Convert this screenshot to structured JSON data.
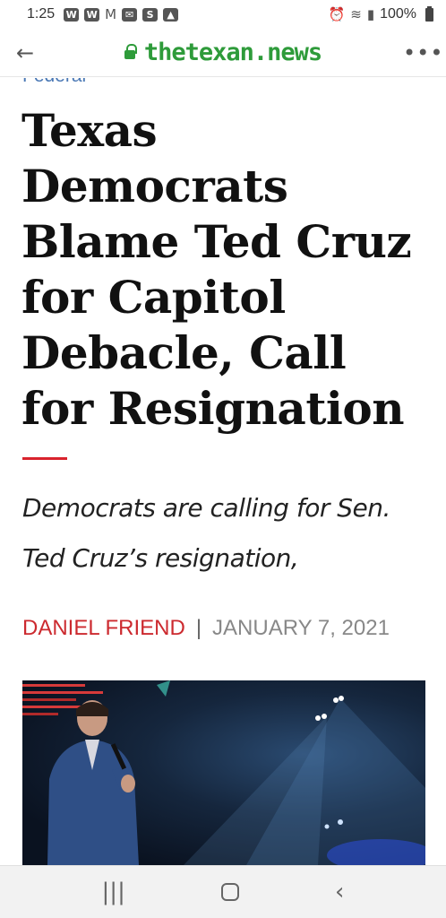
{
  "status_bar": {
    "time": "1:25",
    "battery": "100%",
    "left_icons": [
      "w-app-icon",
      "w-app-icon",
      "gmail-icon",
      "mail-icon",
      "shazam-icon",
      "gallery-icon"
    ],
    "right_icons": [
      "alarm-icon",
      "wifi-icon",
      "signal-icon",
      "battery-icon"
    ]
  },
  "browser": {
    "url": "thetexan.news",
    "back_icon": "back-arrow-icon",
    "menu_icon": "more-icon"
  },
  "article": {
    "category": "Federal",
    "headline_lines": [
      "Texas",
      "Democrats",
      "Blame Ted Cruz",
      "for Capitol",
      "Debacle, Call",
      "for Resignation"
    ],
    "subhead_lines": [
      "Democrats are calling for Sen.",
      "Ted Cruz’s resignation,"
    ],
    "author": "Daniel Friend",
    "separator": "|",
    "date": "January 7, 2021",
    "accent_color": "#d9232d",
    "author_color": "#cc2a2f",
    "category_color": "#4a78b5"
  },
  "nav": {
    "recents_glyph": "|||",
    "back_glyph": "‹"
  }
}
